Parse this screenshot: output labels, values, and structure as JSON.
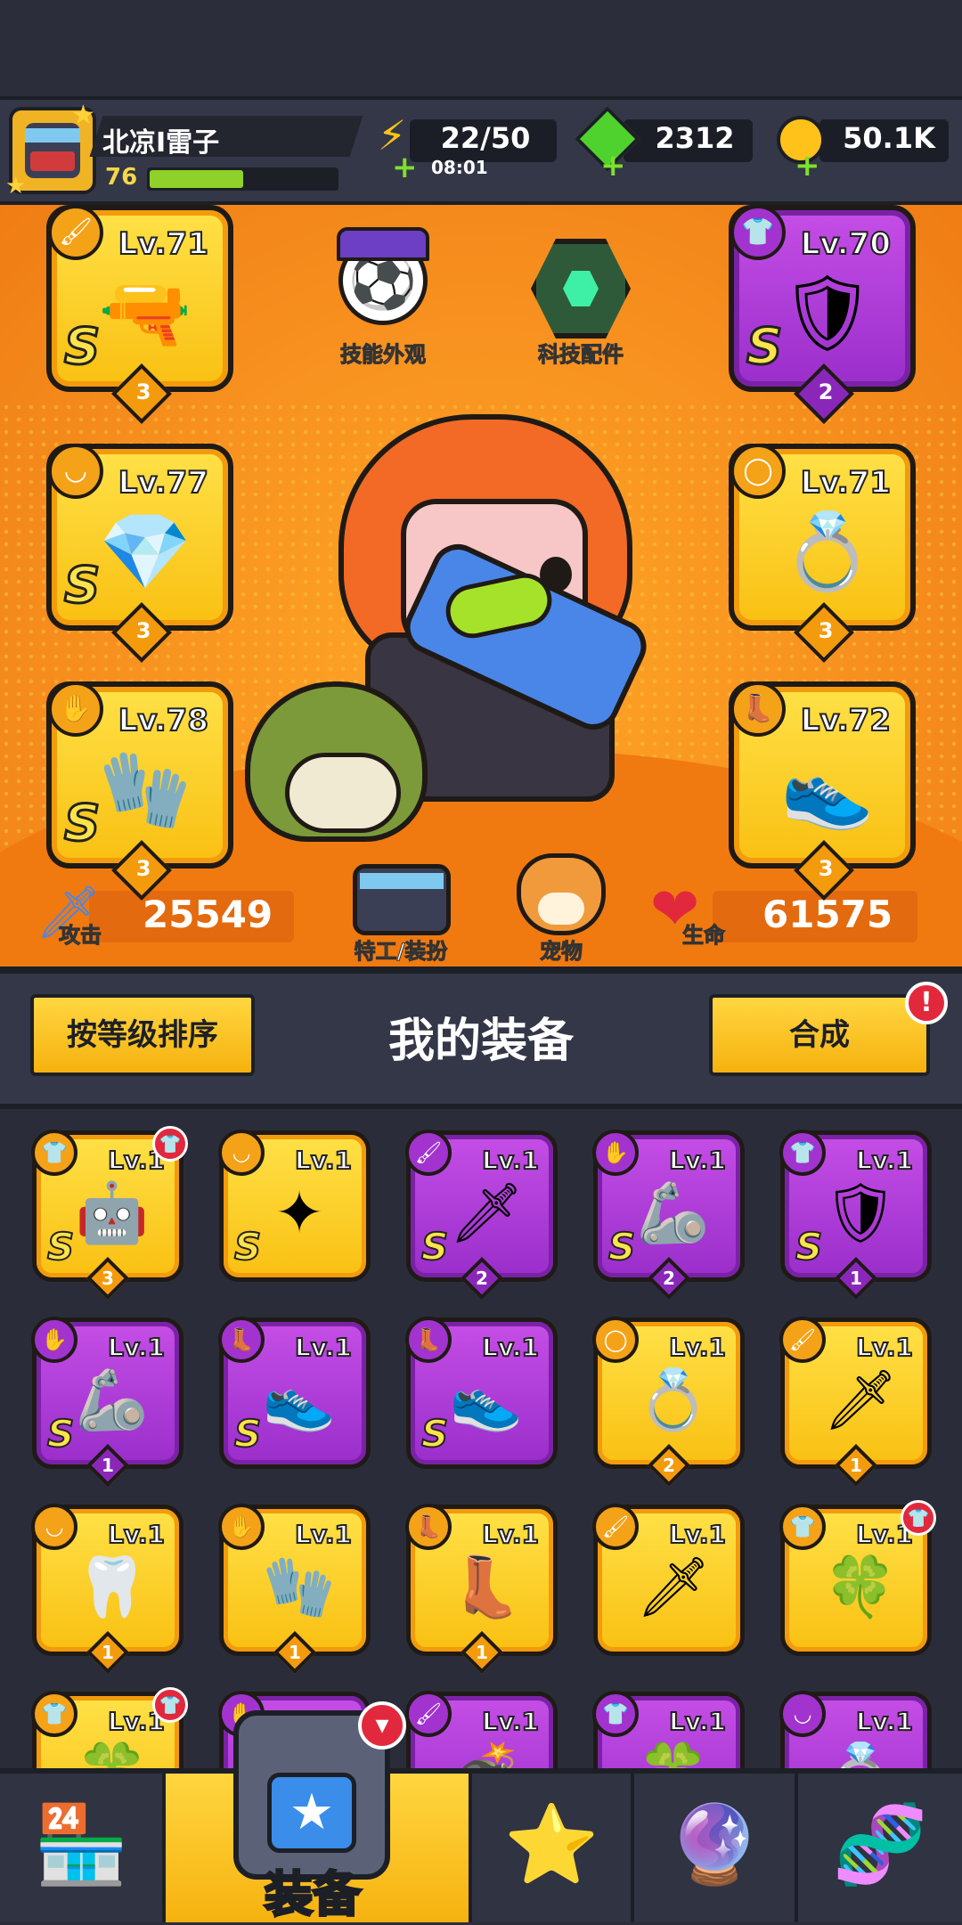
{
  "player": {
    "name": "北凉I雷子",
    "level": "76",
    "xp_fraction": 0.5
  },
  "resources": {
    "energy": "22/50",
    "energy_timer": "08:01",
    "gems": "2312",
    "coins": "50.1K"
  },
  "hero_features": {
    "skill_skin": "技能外观",
    "tech_parts": "科技配件",
    "agent_outfit": "特工/装扮",
    "pet": "宠物"
  },
  "stats": {
    "attack_label": "攻击",
    "attack_value": "25549",
    "hp_label": "生命",
    "hp_value": "61575"
  },
  "equipped": {
    "left": [
      {
        "level": "Lv.71",
        "grade": "S",
        "stars": "3",
        "rarity": "yellow",
        "icon": "water-gun-icon",
        "category": "weapon-icon"
      },
      {
        "level": "Lv.77",
        "grade": "S",
        "stars": "3",
        "rarity": "yellow",
        "icon": "necklace-icon",
        "category": "necklace-category-icon"
      },
      {
        "level": "Lv.78",
        "grade": "S",
        "stars": "3",
        "rarity": "yellow",
        "icon": "gauntlet-icon",
        "category": "glove-category-icon"
      }
    ],
    "right": [
      {
        "level": "Lv.70",
        "grade": "S",
        "stars": "2",
        "rarity": "purple",
        "icon": "armor-icon",
        "category": "armor-category-icon"
      },
      {
        "level": "Lv.71",
        "grade": "",
        "stars": "3",
        "rarity": "yellow",
        "icon": "ring-icon",
        "category": "ring-category-icon"
      },
      {
        "level": "Lv.72",
        "grade": "",
        "stars": "3",
        "rarity": "yellow",
        "icon": "boot-icon",
        "category": "boot-category-icon"
      }
    ]
  },
  "panel": {
    "sort_label": "按等级排序",
    "title": "我的装备",
    "merge_label": "合成",
    "merge_alert": "!"
  },
  "inventory": [
    {
      "level": "Lv.1",
      "grade": "S",
      "stars": "3",
      "rarity": "yellow",
      "icon": "robot-armor-icon",
      "category": "armor-category-icon",
      "badge": true
    },
    {
      "level": "Lv.1",
      "grade": "S",
      "stars": "",
      "rarity": "yellow",
      "icon": "star-necklace-icon",
      "category": "necklace-category-icon",
      "badge": false
    },
    {
      "level": "Lv.1",
      "grade": "S",
      "stars": "2",
      "rarity": "purple",
      "icon": "dark-blade-icon",
      "category": "weapon-icon",
      "badge": false
    },
    {
      "level": "Lv.1",
      "grade": "S",
      "stars": "2",
      "rarity": "purple",
      "icon": "tech-gauntlet-icon",
      "category": "glove-category-icon",
      "badge": false
    },
    {
      "level": "Lv.1",
      "grade": "S",
      "stars": "1",
      "rarity": "purple",
      "icon": "dark-armor-icon",
      "category": "armor-category-icon",
      "badge": false
    },
    {
      "level": "Lv.1",
      "grade": "S",
      "stars": "1",
      "rarity": "purple",
      "icon": "silver-gauntlet-icon",
      "category": "glove-category-icon",
      "badge": false
    },
    {
      "level": "Lv.1",
      "grade": "S",
      "stars": "",
      "rarity": "purple",
      "icon": "gold-boot-icon",
      "category": "boot-category-icon",
      "badge": false
    },
    {
      "level": "Lv.1",
      "grade": "S",
      "stars": "",
      "rarity": "purple",
      "icon": "silver-boot-icon",
      "category": "boot-category-icon",
      "badge": false
    },
    {
      "level": "Lv.1",
      "grade": "",
      "stars": "2",
      "rarity": "yellow",
      "icon": "ring-icon",
      "category": "ring-category-icon",
      "badge": false
    },
    {
      "level": "Lv.1",
      "grade": "",
      "stars": "1",
      "rarity": "yellow",
      "icon": "kunai-icon",
      "category": "weapon-icon",
      "badge": false
    },
    {
      "level": "Lv.1",
      "grade": "",
      "stars": "1",
      "rarity": "yellow",
      "icon": "fang-necklace-icon",
      "category": "necklace-category-icon",
      "badge": false
    },
    {
      "level": "Lv.1",
      "grade": "",
      "stars": "1",
      "rarity": "yellow",
      "icon": "purple-gauntlet-icon",
      "category": "glove-category-icon",
      "badge": false
    },
    {
      "level": "Lv.1",
      "grade": "",
      "stars": "1",
      "rarity": "yellow",
      "icon": "purple-boot-icon",
      "category": "boot-category-icon",
      "badge": false
    },
    {
      "level": "Lv.1",
      "grade": "",
      "stars": "",
      "rarity": "yellow",
      "icon": "kunai-icon",
      "category": "weapon-icon",
      "badge": false
    },
    {
      "level": "Lv.1",
      "grade": "",
      "stars": "",
      "rarity": "yellow",
      "icon": "leaf-armor-icon",
      "category": "armor-category-icon",
      "badge": true
    },
    {
      "level": "Lv.1",
      "grade": "",
      "stars": "",
      "rarity": "yellow",
      "icon": "leaf-armor-icon",
      "category": "armor-category-icon",
      "badge": true
    },
    {
      "level": "",
      "grade": "",
      "stars": "",
      "rarity": "purple",
      "icon": "gauntlet-icon",
      "category": "glove-category-icon",
      "badge": false
    },
    {
      "level": "Lv.1",
      "grade": "",
      "stars": "",
      "rarity": "purple",
      "icon": "bomb-icon",
      "category": "weapon-icon",
      "badge": false
    },
    {
      "level": "Lv.1",
      "grade": "",
      "stars": "",
      "rarity": "purple",
      "icon": "leaf-armor-icon",
      "category": "armor-category-icon",
      "badge": false
    },
    {
      "level": "Lv.1",
      "grade": "",
      "stars": "",
      "rarity": "purple",
      "icon": "ring-icon",
      "category": "necklace-category-icon",
      "badge": false
    }
  ],
  "nav": {
    "shop_icon": "shop-icon",
    "equipment_label": "装备",
    "battle_icon": "star-swords-icon",
    "ball_icon": "gacha-ball-icon",
    "dna_icon": "dna-capsule-icon"
  },
  "colors": {
    "yellow_card": "#f9c012",
    "purple_card": "#9a2ecb",
    "hero_bg": "#f7901f",
    "xp_bar": "#8fd12a"
  }
}
